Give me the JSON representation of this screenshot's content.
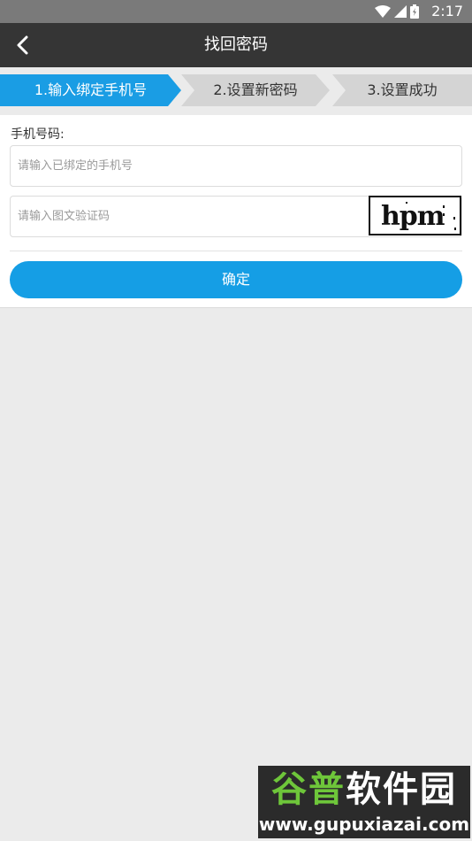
{
  "status_bar": {
    "time": "2:17"
  },
  "header": {
    "title": "找回密码"
  },
  "steps": [
    {
      "label": "1.输入绑定手机号",
      "active": true
    },
    {
      "label": "2.设置新密码",
      "active": false
    },
    {
      "label": "3.设置成功",
      "active": false
    }
  ],
  "form": {
    "phone_label": "手机号码:",
    "phone_placeholder": "请输入已绑定的手机号",
    "captcha_placeholder": "请输入图文验证码",
    "captcha_text": "hpm",
    "confirm_label": "确定"
  },
  "watermark": {
    "line1_part1": "谷普",
    "line1_part2": "软件园",
    "line2": "www.gupuxiazai.com"
  },
  "colors": {
    "accent": "#159ee5",
    "titlebar": "#353535"
  }
}
